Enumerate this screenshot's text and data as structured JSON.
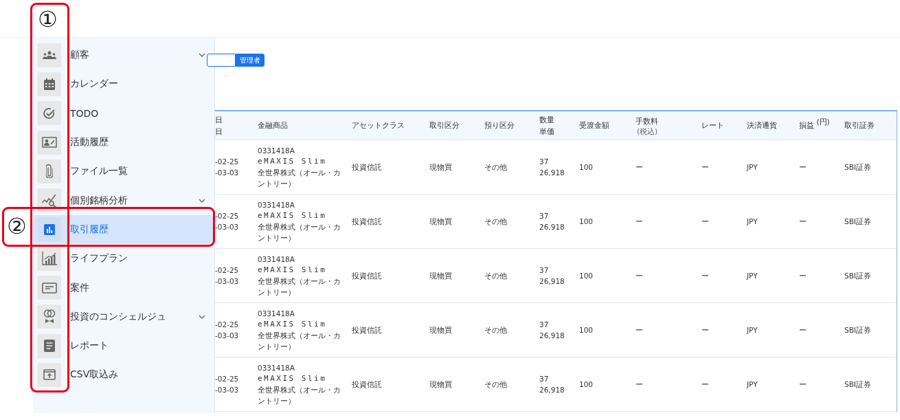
{
  "annotations": [
    {
      "number": "①"
    },
    {
      "number": "②"
    }
  ],
  "sidebar": {
    "items": [
      {
        "label": "顧客",
        "selected": false,
        "expandable": true
      },
      {
        "label": "カレンダー",
        "selected": false,
        "expandable": false
      },
      {
        "label": "TODO",
        "selected": false,
        "expandable": false
      },
      {
        "label": "活動履歴",
        "selected": false,
        "expandable": false
      },
      {
        "label": "ファイル一覧",
        "selected": false,
        "expandable": false
      },
      {
        "label": "個別銘柄分析",
        "selected": false,
        "expandable": true
      },
      {
        "label": "取引履歴",
        "selected": true,
        "expandable": false
      },
      {
        "label": "ライフプラン",
        "selected": false,
        "expandable": false
      },
      {
        "label": "案件",
        "selected": false,
        "expandable": false
      },
      {
        "label": "投資のコンシェルジュ",
        "selected": false,
        "expandable": true
      },
      {
        "label": "レポート",
        "selected": false,
        "expandable": false
      },
      {
        "label": "CSV取込み",
        "selected": false,
        "expandable": false
      }
    ]
  },
  "role_toggle": [
    {
      "selected": false
    },
    {
      "label": "管理者",
      "selected": true
    }
  ],
  "table": {
    "columns": [
      {
        "label": "日",
        "label_2": "日"
      },
      {
        "label": "金融商品"
      },
      {
        "label": "アセットクラス"
      },
      {
        "label": "取引区分"
      },
      {
        "label": "預り区分"
      },
      {
        "label": "数量",
        "label_2": "単価"
      },
      {
        "label": "受渡金額"
      },
      {
        "label": "手数料",
        "note": "(税込)"
      },
      {
        "label": "レート"
      },
      {
        "label": "決済通貨"
      },
      {
        "label": "損益 $^{(円)}$"
      },
      {
        "label": "取引証券"
      }
    ],
    "rows": [
      {
        "date_1": "-02-25",
        "date_2": "-03-03",
        "code": "0331418A",
        "name": "eMAXIS Slim",
        "detail": "全世界株式（オール・カントリー）",
        "asset": "投資信託",
        "trade": "現物買",
        "custody": "その他",
        "qty": "37",
        "price": "26,918",
        "amount": "100",
        "fee": "ー",
        "rate": "ー",
        "currency": "JPY",
        "pnl": "ー",
        "broker": "SBI証券"
      },
      {
        "date_1": "-02-25",
        "date_2": "-03-03",
        "code": "0331418A",
        "name": "eMAXIS Slim",
        "detail": "全世界株式（オール・カントリー）",
        "asset": "投資信託",
        "trade": "現物買",
        "custody": "その他",
        "qty": "37",
        "price": "26,918",
        "amount": "100",
        "fee": "ー",
        "rate": "ー",
        "currency": "JPY",
        "pnl": "ー",
        "broker": "SBI証券"
      },
      {
        "date_1": "-02-25",
        "date_2": "-03-03",
        "code": "0331418A",
        "name": "eMAXIS Slim",
        "detail": "全世界株式（オール・カントリー）",
        "asset": "投資信託",
        "trade": "現物買",
        "custody": "その他",
        "qty": "37",
        "price": "26,918",
        "amount": "100",
        "fee": "ー",
        "rate": "ー",
        "currency": "JPY",
        "pnl": "ー",
        "broker": "SBI証券"
      },
      {
        "date_1": "-02-25",
        "date_2": "-03-03",
        "code": "0331418A",
        "name": "eMAXIS Slim",
        "detail": "全世界株式（オール・カントリー）",
        "asset": "投資信託",
        "trade": "現物買",
        "custody": "その他",
        "qty": "37",
        "price": "26,918",
        "amount": "100",
        "fee": "ー",
        "rate": "ー",
        "currency": "JPY",
        "pnl": "ー",
        "broker": "SBI証券"
      },
      {
        "date_1": "-02-25",
        "date_2": "-03-03",
        "code": "0331418A",
        "name": "eMAXIS Slim",
        "detail": "全世界株式（オール・カントリー）",
        "asset": "投資信託",
        "trade": "現物買",
        "custody": "その他",
        "qty": "37",
        "price": "26,918",
        "amount": "100",
        "fee": "ー",
        "rate": "ー",
        "currency": "JPY",
        "pnl": "ー",
        "broker": "SBI証券"
      }
    ]
  }
}
